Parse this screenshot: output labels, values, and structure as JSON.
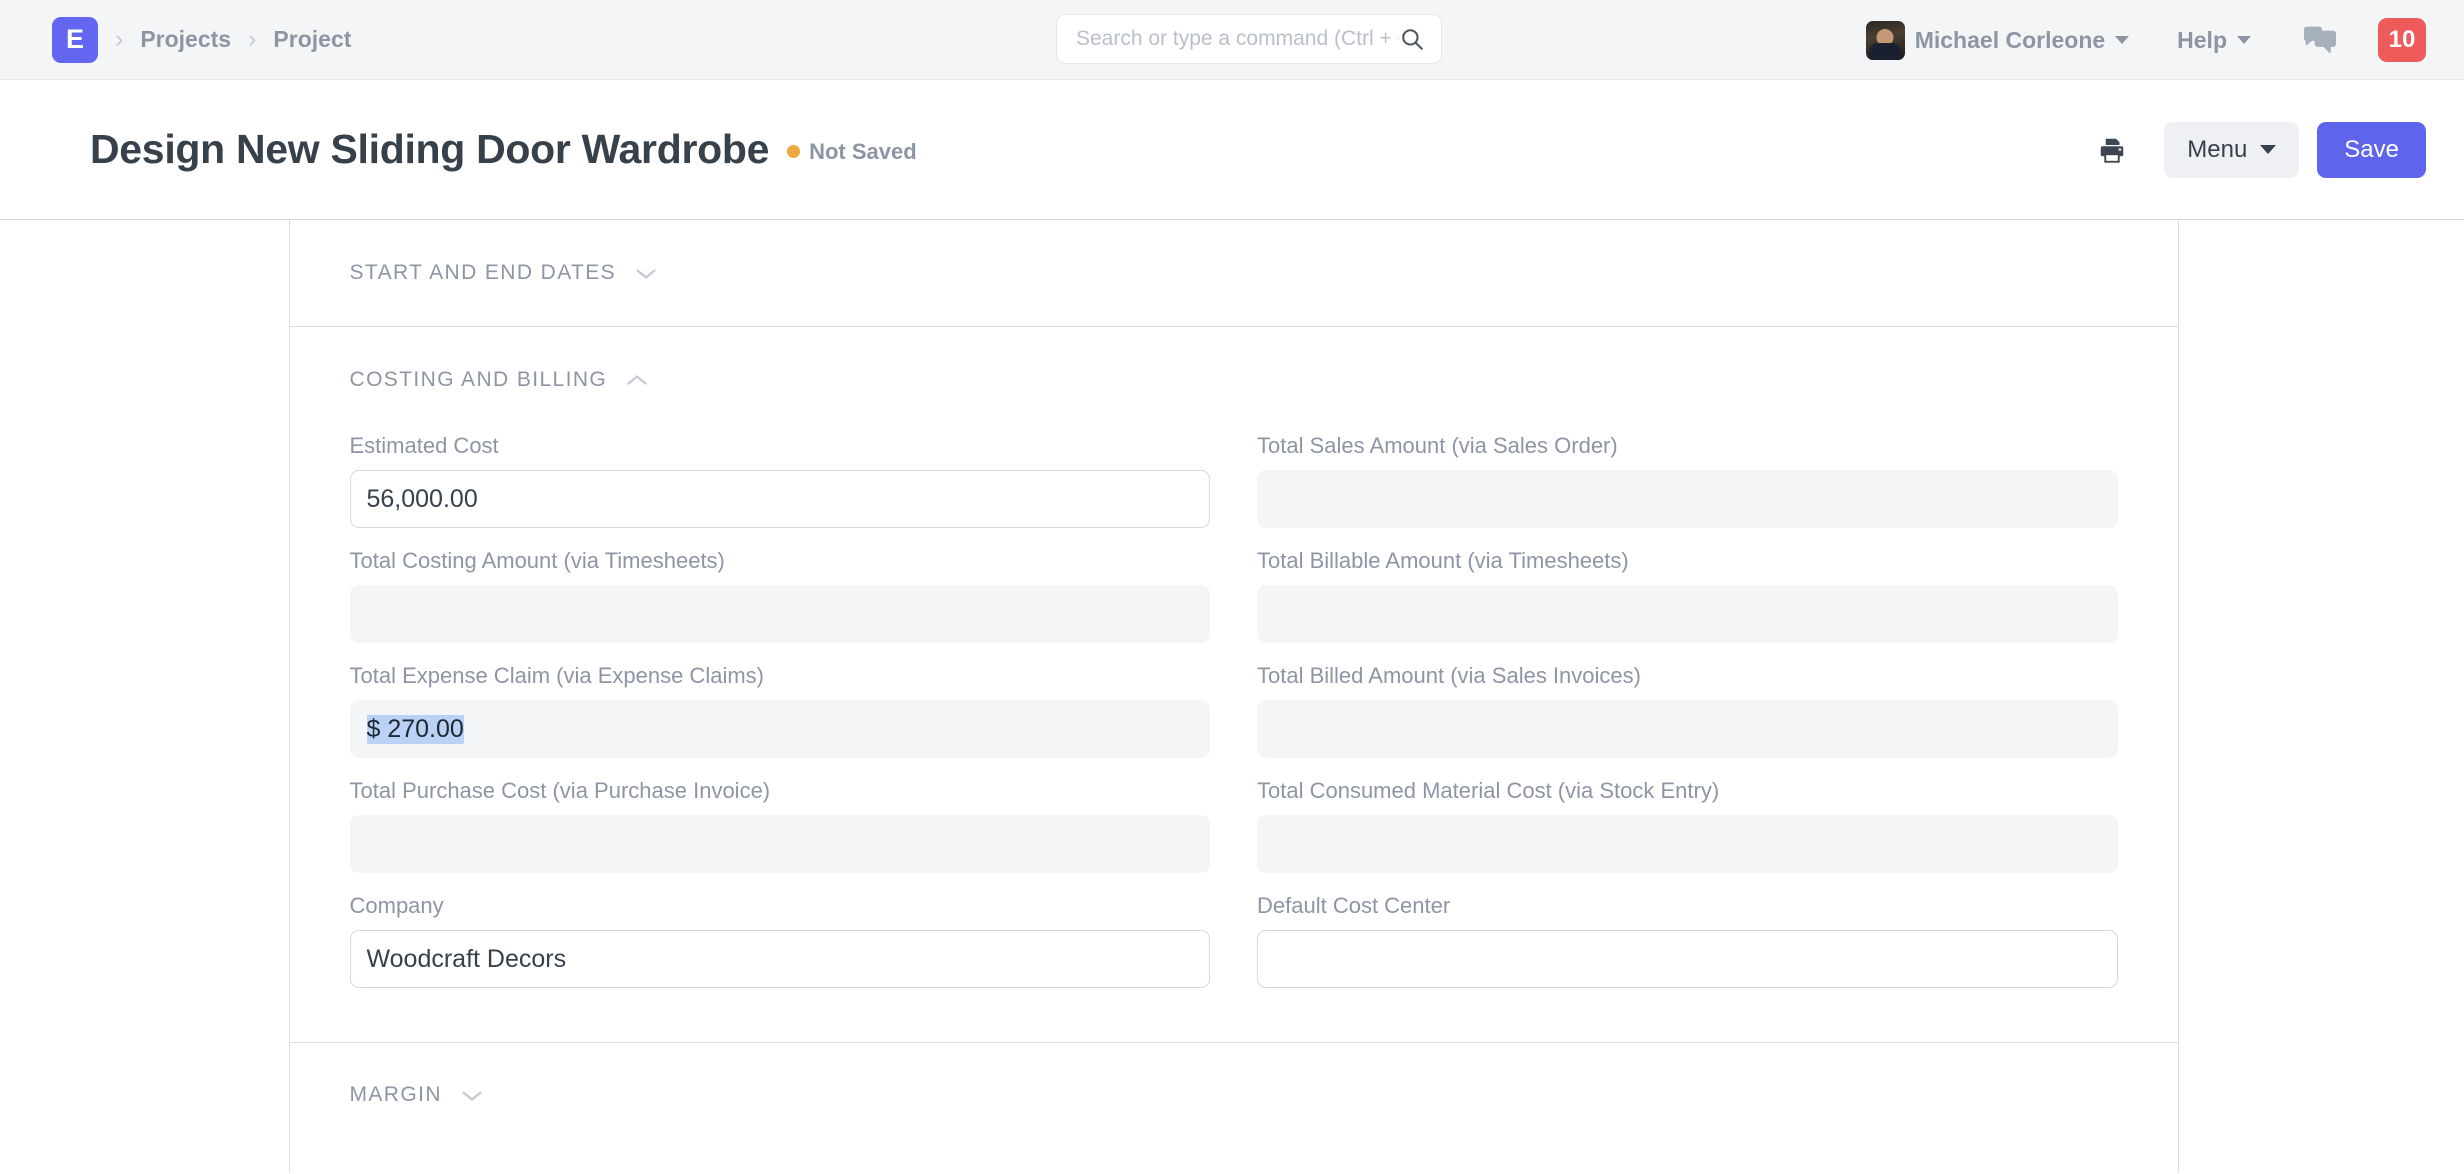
{
  "navbar": {
    "logo_letter": "E",
    "breadcrumbs": [
      {
        "label": "Projects"
      },
      {
        "label": "Project"
      }
    ],
    "search": {
      "placeholder": "Search or type a command (Ctrl + G)",
      "value": "",
      "icon": "search-icon"
    },
    "user": {
      "name": "Michael Corleone",
      "avatar": "user-avatar"
    },
    "help": {
      "label": "Help"
    },
    "chat": {
      "icon": "chat-bubbles-icon"
    },
    "notifications": {
      "count": "10",
      "color": "#ef5b5b"
    }
  },
  "page_header": {
    "title": "Design New Sliding Door Wardrobe",
    "status": {
      "text": "Not Saved",
      "dot_color": "#f0a73f"
    },
    "print": {
      "icon": "printer-icon"
    },
    "menu": {
      "label": "Menu"
    },
    "save": {
      "label": "Save",
      "color": "#5e64ec"
    }
  },
  "sections": {
    "start_and_end_dates": {
      "label": "Start and End Dates",
      "collapsed": true,
      "chevron": "chevron-down-icon"
    },
    "costing_and_billing": {
      "label": "Costing and Billing",
      "collapsed": false,
      "chevron": "chevron-up-icon",
      "fields": {
        "estimated_cost": {
          "label": "Estimated Cost",
          "value": "56,000.00",
          "readonly": false
        },
        "total_sales_amount": {
          "label": "Total Sales Amount (via Sales Order)",
          "value": "",
          "readonly": true
        },
        "total_costing_amount": {
          "label": "Total Costing Amount (via Timesheets)",
          "value": "",
          "readonly": true
        },
        "total_billable_amount": {
          "label": "Total Billable Amount (via Timesheets)",
          "value": "",
          "readonly": true
        },
        "total_expense_claim": {
          "label": "Total Expense Claim (via Expense Claims)",
          "value": "$ 270.00",
          "readonly": true,
          "selected": true
        },
        "total_billed_amount": {
          "label": "Total Billed Amount (via Sales Invoices)",
          "value": "",
          "readonly": true
        },
        "total_purchase_cost": {
          "label": "Total Purchase Cost (via Purchase Invoice)",
          "value": "",
          "readonly": true
        },
        "total_consumed_material_cost": {
          "label": "Total Consumed Material Cost (via Stock Entry)",
          "value": "",
          "readonly": true
        },
        "company": {
          "label": "Company",
          "value": "Woodcraft Decors",
          "readonly": false
        },
        "default_cost_center": {
          "label": "Default Cost Center",
          "value": "",
          "readonly": false
        }
      }
    },
    "margin": {
      "label": "Margin",
      "collapsed": true,
      "chevron": "chevron-down-icon"
    }
  }
}
